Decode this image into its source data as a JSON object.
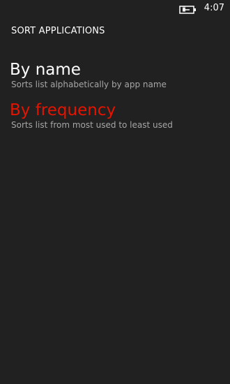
{
  "status_bar": {
    "battery_icon": "battery-charging-icon",
    "time": "4:07"
  },
  "page": {
    "title": "SORT APPLICATIONS"
  },
  "options": [
    {
      "label": "By name",
      "description": "Sorts list alphabetically by app name",
      "selected": false
    },
    {
      "label": "By frequency",
      "description": "Sorts list from most used to least used",
      "selected": true
    }
  ],
  "colors": {
    "background": "#212121",
    "accent": "#e51400",
    "text": "#ffffff",
    "secondary_text": "#a6a6a6"
  }
}
